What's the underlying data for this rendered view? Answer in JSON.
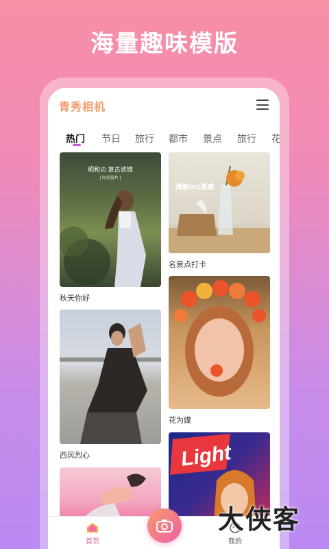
{
  "headline": "海量趣味模版",
  "app": {
    "logo": "青秀相机"
  },
  "tabs": [
    {
      "label": "热门",
      "active": true
    },
    {
      "label": "节日",
      "active": false
    },
    {
      "label": "旅行",
      "active": false
    },
    {
      "label": "都市",
      "active": false
    },
    {
      "label": "景点",
      "active": false
    },
    {
      "label": "旅行",
      "active": false
    },
    {
      "label": "花",
      "active": false
    }
  ],
  "cards": {
    "autumn": {
      "caption": "秋天你好",
      "overlay": "昭和の 复古滤镜",
      "overlay_sub": "[ 时光胶片 ]"
    },
    "scenic": {
      "caption": "名景点打卡",
      "overlay": "清新INS质感",
      "overlay_sub": "CLEAR"
    },
    "flower": {
      "caption": "花为媒"
    },
    "west": {
      "caption": "西风烈心"
    },
    "light": {
      "overlay": "Light"
    }
  },
  "nav": {
    "home": "首页",
    "mine": "我的"
  },
  "watermark": "大侠客",
  "colors": {
    "accent": "#c35bd9",
    "logo": "#f59a6c",
    "camera_start": "#f89a6a",
    "camera_end": "#ef5fa6"
  }
}
